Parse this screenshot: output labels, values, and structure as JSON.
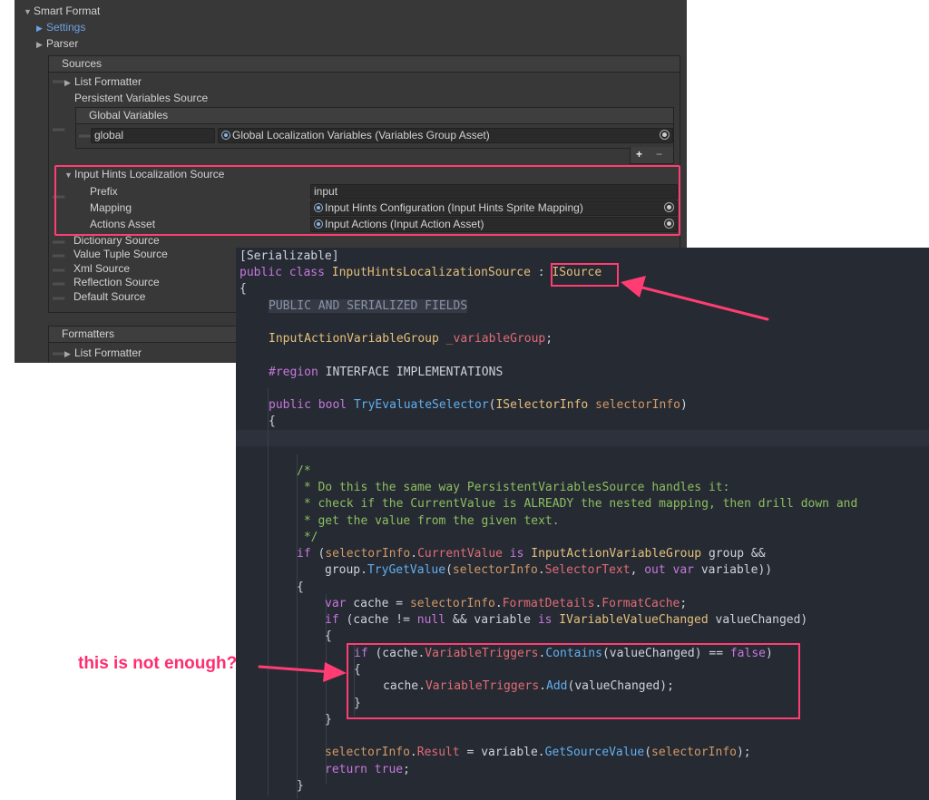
{
  "inspector": {
    "smart_format": "Smart Format",
    "settings": "Settings",
    "parser": "Parser",
    "sources": {
      "title": "Sources",
      "list_formatter": "List Formatter",
      "persistent_variables_source": "Persistent Variables Source",
      "global_variables": "Global Variables",
      "global_key": "global",
      "global_value": "Global Localization Variables (Variables Group Asset)",
      "add": "+",
      "remove": "−",
      "input_hints": {
        "title": "Input Hints Localization Source",
        "prefix_label": "Prefix",
        "prefix_value": "input",
        "mapping_label": "Mapping",
        "mapping_value": "Input Hints Configuration (Input Hints Sprite Mapping)",
        "actions_label": "Actions Asset",
        "actions_value": "Input Actions (Input Action Asset)"
      },
      "dictionary_source": "Dictionary Source",
      "value_tuple_source": "Value Tuple Source",
      "xml_source": "Xml Source",
      "reflection_source": "Reflection Source",
      "default_source": "Default Source"
    },
    "formatters": {
      "title": "Formatters",
      "list_formatter": "List Formatter"
    }
  },
  "code": {
    "l1": "[Serializable]",
    "l2_public": "public",
    "l2_class": "class",
    "l2_name": "InputHintsLocalizationSource",
    "l2_colon": " : ",
    "l2_iface": "ISource",
    "l3": "{",
    "l4": "PUBLIC AND SERIALIZED FIELDS",
    "l5_type": "InputActionVariableGroup",
    "l5_field": "_variableGroup",
    "l5_end": ";",
    "l6_region": "#region",
    "l6_text": " INTERFACE IMPLEMENTATIONS",
    "l7_public": "public",
    "l7_bool": "bool",
    "l7_fn": "TryEvaluateSelector",
    "l7_open": "(",
    "l7_ptype": "ISelectorInfo",
    "l7_pname": "selectorInfo",
    "l7_close": ")",
    "l8": "{",
    "c1": "/*",
    "c2": " * Do this the same way PersistentVariablesSource handles it:",
    "c3": " * check if the CurrentValue is ALREADY the nested mapping, then drill down and",
    "c4": " * get the value from the given text.",
    "c5": " */",
    "if1_if": "if",
    "if1_a": " (",
    "if1_sel": "selectorInfo",
    "if1_dot": ".",
    "if1_cur": "CurrentValue",
    "if1_is": " is ",
    "if1_type": "InputActionVariableGroup",
    "if1_rest": " group &&",
    "if2_group": "group.",
    "if2_fn": "TryGetValue",
    "if2_a": "(",
    "if2_sel": "selectorInfo",
    "if2_dot": ".",
    "if2_prop": "SelectorText",
    "if2_b": ", ",
    "if2_out": "out",
    "if2_sp": " ",
    "if2_var": "var",
    "if2_end": " variable))",
    "b1": "{",
    "v_var": "var",
    "v_cache": " cache = ",
    "v_sel": "selectorInfo",
    "v_dot1": ".",
    "v_fd": "FormatDetails",
    "v_dot2": ".",
    "v_fc": "FormatCache",
    "v_end": ";",
    "if3_if": "if",
    "if3_a": " (cache != ",
    "if3_null": "null",
    "if3_b": " && variable ",
    "if3_is": "is",
    "if3_sp": " ",
    "if3_type": "IVariableValueChanged",
    "if3_end": " valueChanged)",
    "b2": "{",
    "if4_if": "if",
    "if4_a": " (cache.",
    "if4_vt": "VariableTriggers",
    "if4_dot": ".",
    "if4_fn": "Contains",
    "if4_b": "(valueChanged) == ",
    "if4_false": "false",
    "if4_end": ")",
    "b3": "{",
    "add_a": "cache.",
    "add_vt": "VariableTriggers",
    "add_dot": ".",
    "add_fn": "Add",
    "add_end": "(valueChanged);",
    "b3c": "}",
    "b2c": "}",
    "r_sel": "selectorInfo",
    "r_dot": ".",
    "r_res": "Result",
    "r_mid": " = variable.",
    "r_fn": "GetSourceValue",
    "r_a": "(",
    "r_arg": "selectorInfo",
    "r_end": ");",
    "ret_kw": "return",
    "ret_sp": " ",
    "ret_val": "true",
    "ret_end": ";",
    "b1c": "}"
  },
  "annotation": {
    "note": "this is not enough?",
    "color": "#ff2d6e"
  }
}
